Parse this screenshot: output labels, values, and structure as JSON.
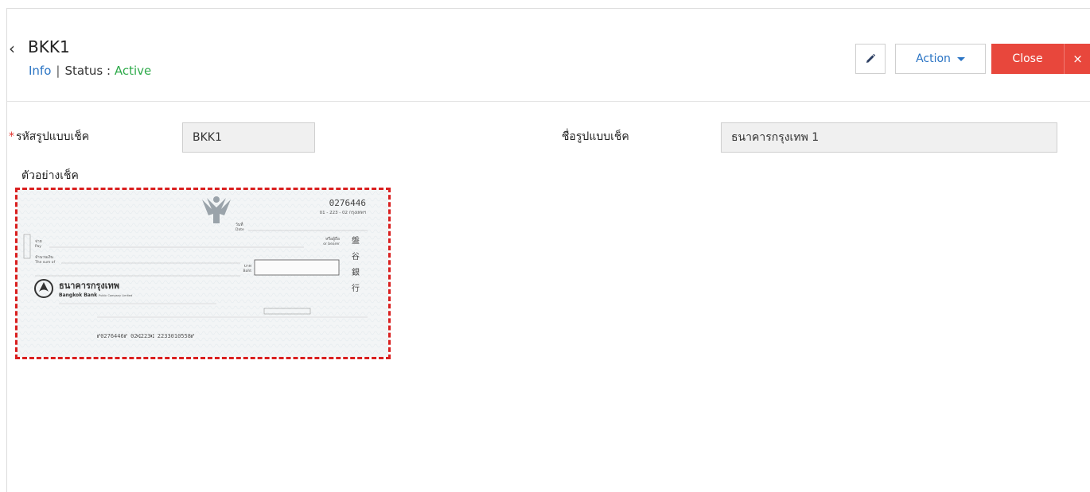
{
  "header": {
    "title": "BKK1",
    "info_link": "Info",
    "separator": "|",
    "status_label": "Status",
    "status_colon": ":",
    "status_value": "Active",
    "action_label": "Action",
    "close_label": "Close",
    "close_x": "×"
  },
  "form": {
    "code_required_mark": "*",
    "code_label": "รหัสรูปแบบเช็ค",
    "code_value": "BKK1",
    "name_label": "ชื่อรูปแบบเช็ค",
    "name_value": "ธนาคารกรุงเทพ 1",
    "sample_label": "ตัวอย่างเช็ค"
  },
  "check": {
    "number": "0276446",
    "branch_code": "01 - 223 - 02 กรุงเทพฯ",
    "date_th": "วันที่",
    "date_en": "Date",
    "pay_th": "จ่าย",
    "pay_en": "Pay",
    "sum_th": "จำนวนเงิน",
    "sum_en": "The sum of",
    "bearer_th": "หรือผู้ถือ",
    "bearer_en": "or bearer",
    "baht_th": "บาท",
    "baht_en": "Baht",
    "bank_name_th": "ธนาคารกรุงเทพ",
    "bank_name_en": "Bangkok Bank",
    "bank_name_en_suffix": "Public Company Limited",
    "side_chars": [
      "盤",
      "谷",
      "銀",
      "行"
    ],
    "micr_line": "⑈0276446⑈   02⑆223⑆ 2233010558⑈"
  },
  "colors": {
    "accent_blue": "#2a74c4",
    "status_green": "#2eaa4a",
    "close_red": "#e8473c",
    "dashed_red": "#d91f1f"
  }
}
